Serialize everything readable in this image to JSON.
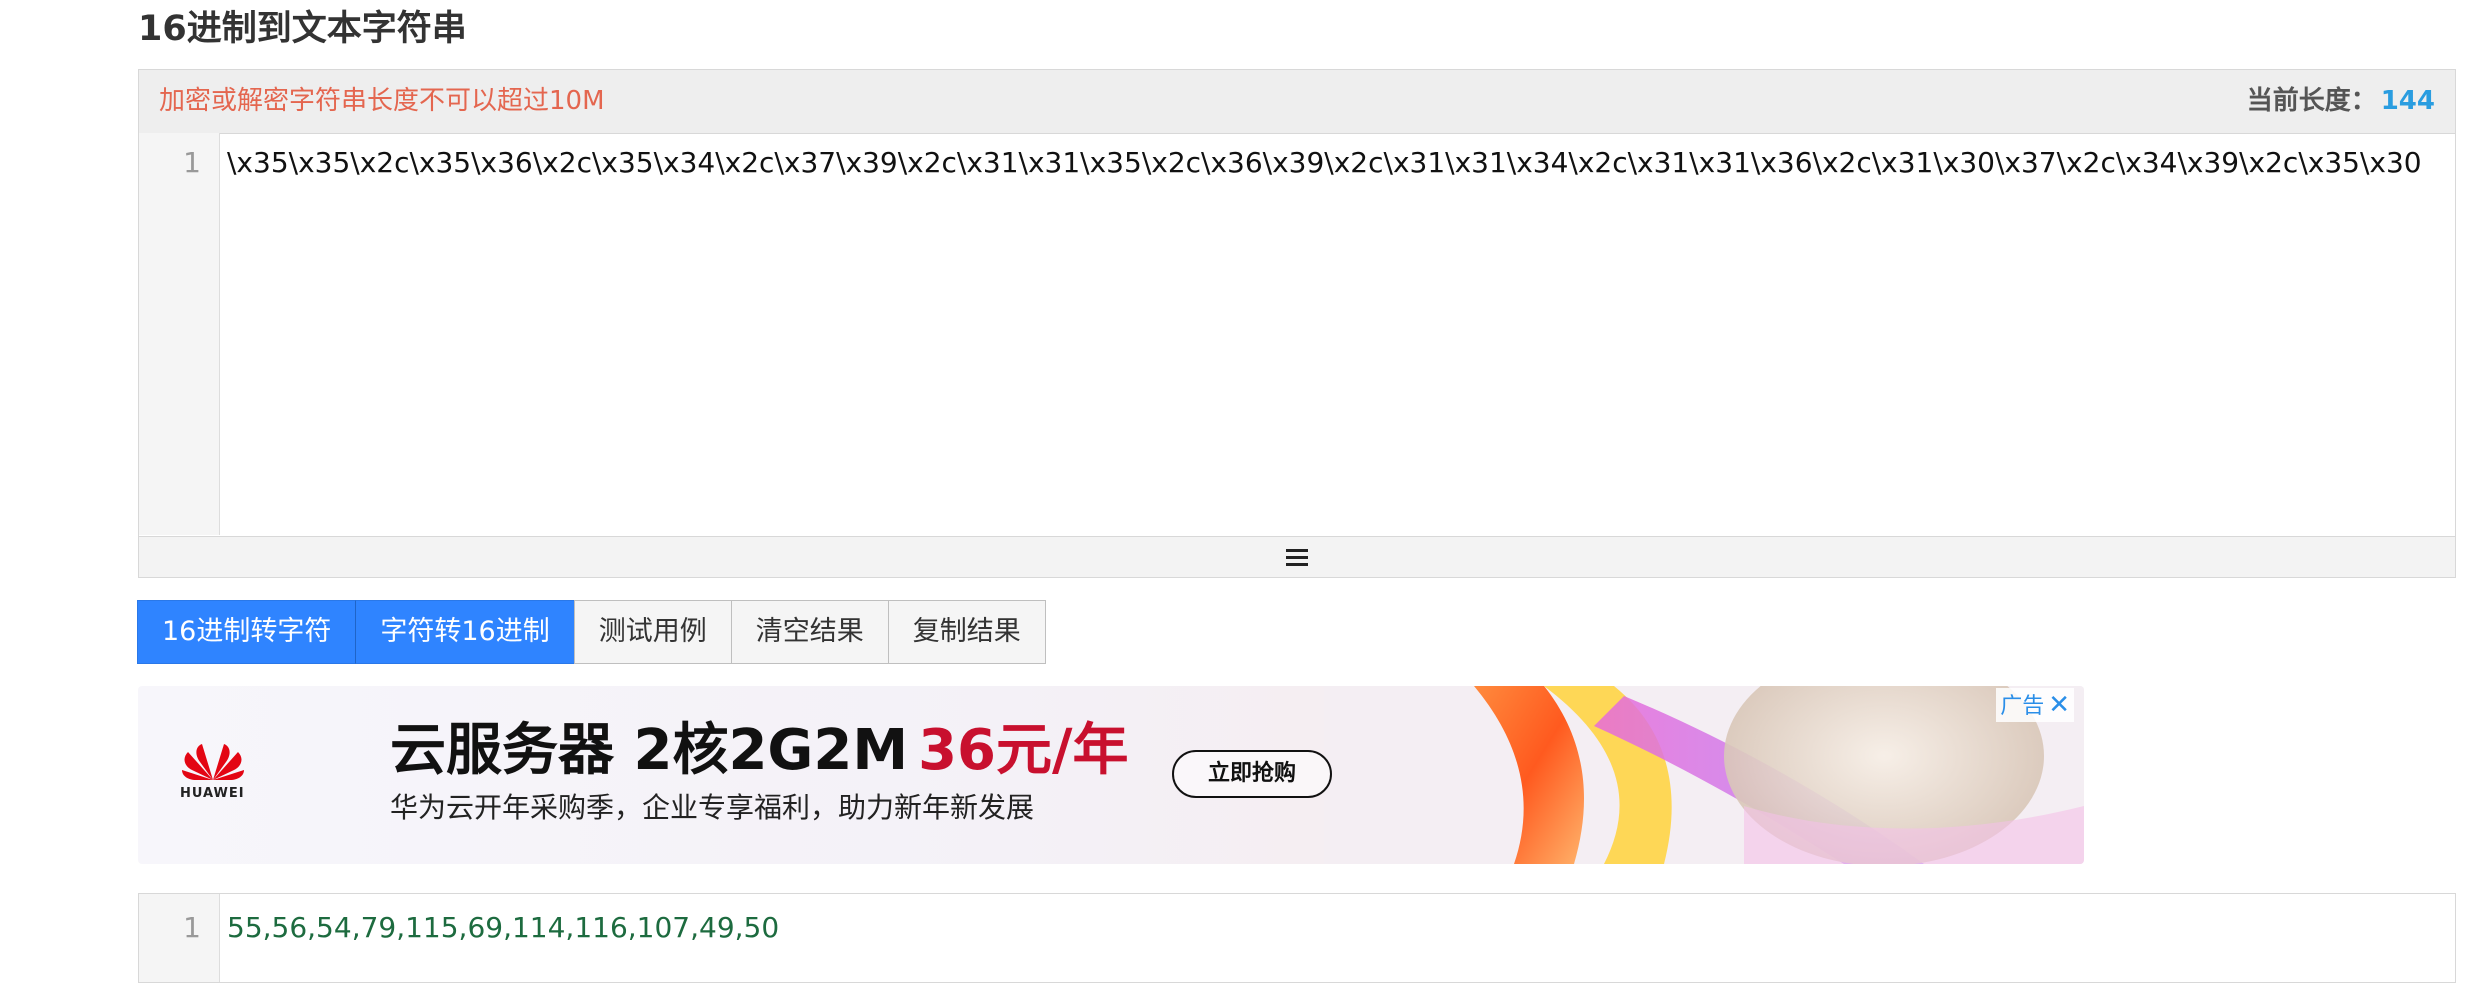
{
  "page": {
    "title": "16进制到文本字符串"
  },
  "input_panel": {
    "warning": "加密或解密字符串长度不可以超过10M",
    "length_label": "当前长度：",
    "length_value": "144",
    "line_number": "1",
    "content": "\\x35\\x35\\x2c\\x35\\x36\\x2c\\x35\\x34\\x2c\\x37\\x39\\x2c\\x31\\x31\\x35\\x2c\\x36\\x39\\x2c\\x31\\x31\\x34\\x2c\\x31\\x31\\x36\\x2c\\x31\\x30\\x37\\x2c\\x34\\x39\\x2c\\x35\\x30",
    "resize_icon": "menu-icon"
  },
  "toolbar": {
    "hex_to_char": "16进制转字符",
    "char_to_hex": "字符转16进制",
    "test_case": "测试用例",
    "clear_result": "清空结果",
    "copy_result": "复制结果"
  },
  "ad": {
    "brand": "HUAWEI",
    "title_main": "云服务器 2核2G2M",
    "title_price": "36元/年",
    "subtitle": "华为云开年采购季，企业专享福利，助力新年新发展",
    "cta": "立即抢购",
    "badge": "广告",
    "close_icon": "close-icon",
    "colors": {
      "price": "#c8102e",
      "badge": "#2a8ee8"
    }
  },
  "output_panel": {
    "line_number": "1",
    "content": "55,56,54,79,115,69,114,116,107,49,50"
  },
  "colors": {
    "primary_button": "#2f84ff",
    "warning_text": "#e4664f",
    "length_value": "#2a9de0",
    "output_text": "#1d6b3f"
  }
}
